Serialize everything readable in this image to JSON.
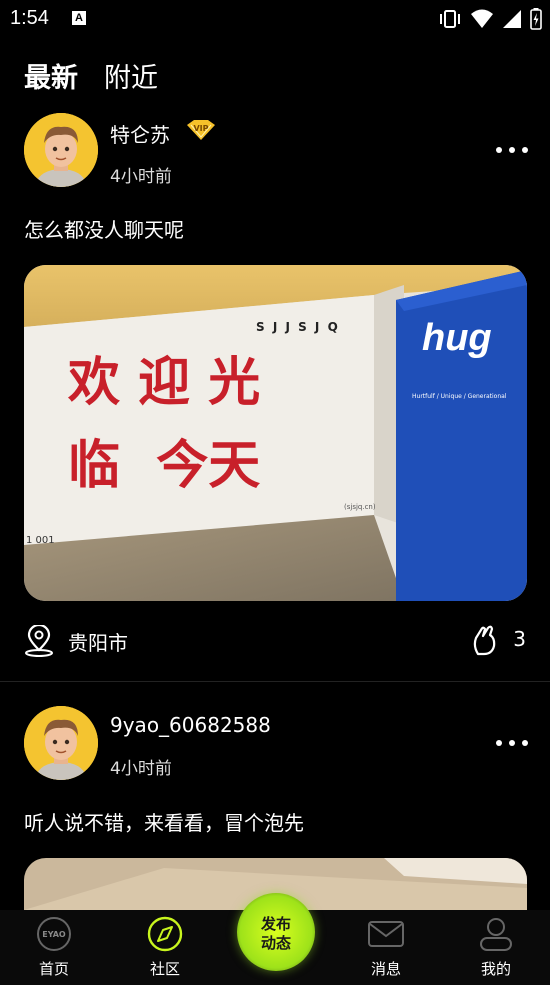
{
  "status_bar": {
    "time": "1:54",
    "notification_letter": "A"
  },
  "tabs": [
    {
      "label": "最新",
      "active": true
    },
    {
      "label": "附近",
      "active": false
    }
  ],
  "posts": [
    {
      "username": "特仑苏",
      "badge": "VIP",
      "time_ago": "4小时前",
      "text": "怎么都没人聊天呢",
      "image_text": {
        "wall_top": "S J J S J Q",
        "line1": "欢 迎 光",
        "line2": "临  今天",
        "small_label": "(sjsjq.cn)",
        "floor_number": "1 001",
        "sign_brand": "hug",
        "sign_tagline": "Hurtfulf / Unique / Generational"
      },
      "location": "贵阳市",
      "likes": "3"
    },
    {
      "username": "9yao_60682588",
      "time_ago": "4小时前",
      "text": "听人说不错，来看看，冒个泡先"
    }
  ],
  "bottom_nav": {
    "items": [
      {
        "label": "首页",
        "icon_text": "EYAO"
      },
      {
        "label": "社区"
      },
      {
        "label": "消息"
      },
      {
        "label": "我的"
      }
    ],
    "publish_line1": "发布",
    "publish_line2": "动态"
  },
  "colors": {
    "accent": "#c8f51e",
    "vip_gold": "#f6c12a",
    "sign_blue": "#1f4fb8",
    "wall_red": "#c8202a"
  }
}
